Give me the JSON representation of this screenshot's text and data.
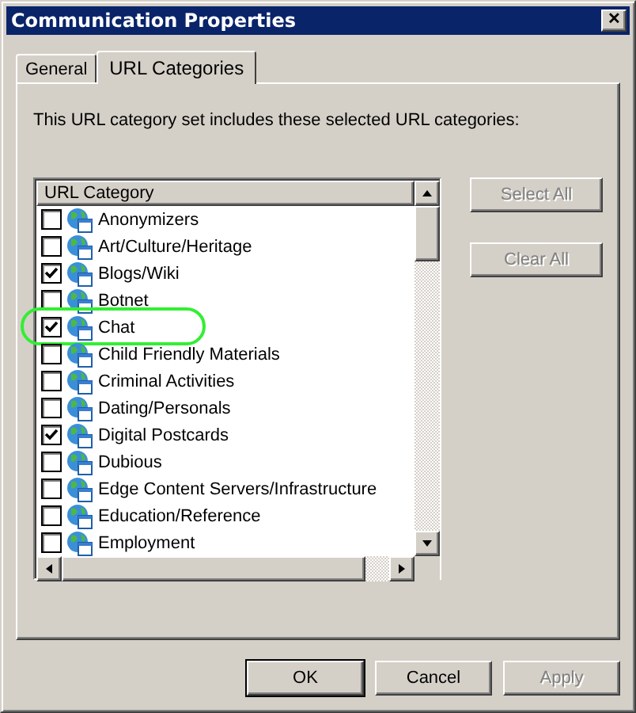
{
  "window": {
    "title": "Communication Properties",
    "close": "✕"
  },
  "tabs": [
    {
      "label": "General",
      "selected": false
    },
    {
      "label": "URL Categories",
      "selected": true
    }
  ],
  "intro": "This URL category set includes these selected URL categories:",
  "list": {
    "column": "URL Category",
    "items": [
      {
        "label": "Anonymizers",
        "checked": false,
        "highlighted": false
      },
      {
        "label": "Art/Culture/Heritage",
        "checked": false,
        "highlighted": false
      },
      {
        "label": "Blogs/Wiki",
        "checked": true,
        "highlighted": false
      },
      {
        "label": "Botnet",
        "checked": false,
        "highlighted": false
      },
      {
        "label": "Chat",
        "checked": true,
        "highlighted": true
      },
      {
        "label": "Child Friendly Materials",
        "checked": false,
        "highlighted": false
      },
      {
        "label": "Criminal Activities",
        "checked": false,
        "highlighted": false
      },
      {
        "label": "Dating/Personals",
        "checked": false,
        "highlighted": false
      },
      {
        "label": "Digital Postcards",
        "checked": true,
        "highlighted": false
      },
      {
        "label": "Dubious",
        "checked": false,
        "highlighted": false
      },
      {
        "label": "Edge Content Servers/Infrastructure",
        "checked": false,
        "highlighted": false
      },
      {
        "label": "Education/Reference",
        "checked": false,
        "highlighted": false
      },
      {
        "label": "Employment",
        "checked": false,
        "highlighted": false
      }
    ]
  },
  "side_buttons": [
    {
      "label": "Select All",
      "disabled": true
    },
    {
      "label": "Clear All",
      "disabled": true
    }
  ],
  "footer_buttons": [
    {
      "label": "OK",
      "disabled": false,
      "default": true
    },
    {
      "label": "Cancel",
      "disabled": false,
      "default": false
    },
    {
      "label": "Apply",
      "disabled": true,
      "default": false
    }
  ]
}
